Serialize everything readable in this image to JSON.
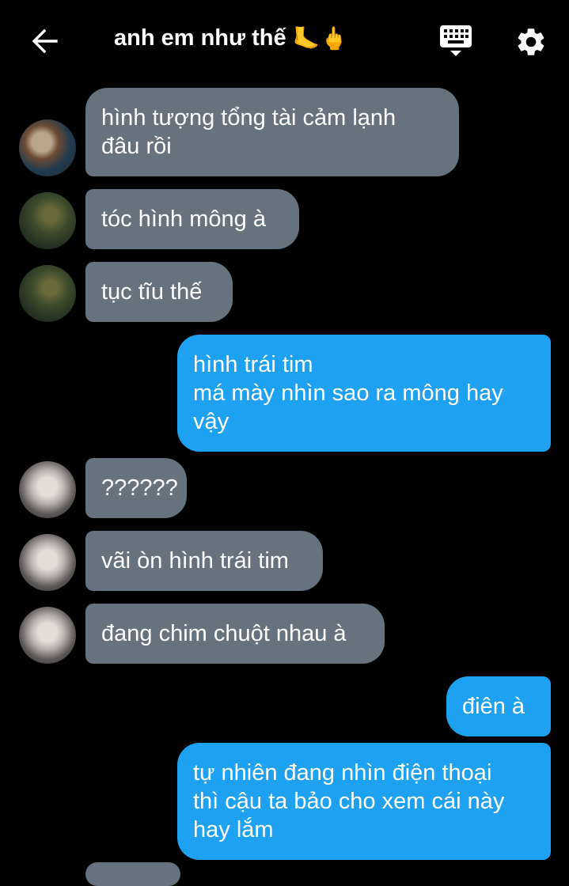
{
  "header": {
    "title": "anh em như thế",
    "title_emojis": "🦶🖕",
    "icons": {
      "back": "arrow-left-icon",
      "keyboard": "keyboard-icon",
      "settings": "gear-icon"
    }
  },
  "messages": [
    {
      "side": "in",
      "avatar": "avatar-a",
      "text": "hình tượng tổng tài cảm lạnh\nđâu rồi"
    },
    {
      "side": "in",
      "avatar": "avatar-b",
      "text": "tóc hình mông à"
    },
    {
      "side": "in",
      "avatar": "avatar-b",
      "text": "tục tĩu thế"
    },
    {
      "side": "out",
      "text": "hình trái tim\nmá mày nhìn sao ra mông hay\nvậy"
    },
    {
      "side": "in",
      "avatar": "avatar-c",
      "text": "??????"
    },
    {
      "side": "in",
      "avatar": "avatar-c",
      "text": "vãi òn hình trái tim"
    },
    {
      "side": "in",
      "avatar": "avatar-c",
      "text": "đang chim chuột nhau à"
    },
    {
      "side": "out",
      "text": "điên à"
    },
    {
      "side": "out",
      "text": "tự nhiên đang nhìn điện thoại\nthì cậu ta bảo cho xem cái này\nhay lắm"
    }
  ],
  "colors": {
    "background": "#000000",
    "incoming_bubble": "#66737f",
    "outgoing_bubble": "#1ea1f1",
    "text": "#ffffff"
  }
}
